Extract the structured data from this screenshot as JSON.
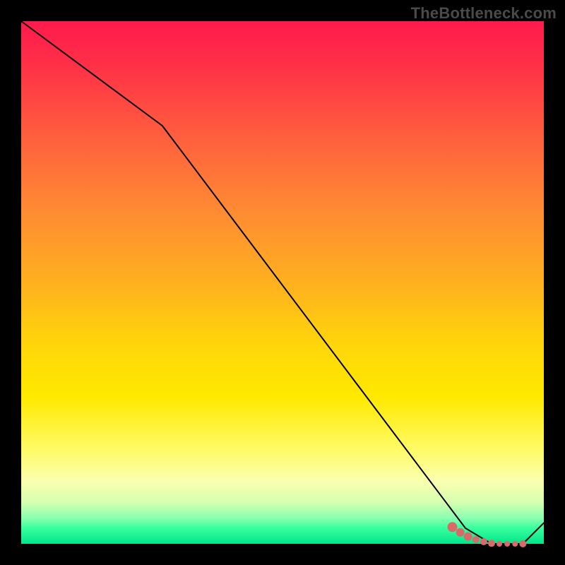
{
  "watermark": "TheBottleneck.com",
  "colors": {
    "background": "#000000",
    "curve": "#000000",
    "dots": "#d86a6a"
  },
  "chart_data": {
    "type": "line",
    "title": "",
    "xlabel": "",
    "ylabel": "",
    "xlim": [
      0,
      100
    ],
    "ylim": [
      0,
      100
    ],
    "grid": false,
    "legend": false,
    "series": [
      {
        "name": "bottleneck-curve",
        "x": [
          0,
          27,
          85,
          90,
          96,
          100
        ],
        "y": [
          100,
          80,
          3,
          0,
          0,
          4
        ]
      }
    ],
    "markers": {
      "name": "highlight-dots",
      "x": [
        82.5,
        84.0,
        85.5,
        87.0,
        88.5,
        90.0,
        91.5,
        93.0,
        94.5,
        96.0
      ],
      "y": [
        3.2,
        2.2,
        1.4,
        0.8,
        0.4,
        0.1,
        0.0,
        0.0,
        0.0,
        0.0
      ],
      "size": [
        7,
        6,
        6,
        5,
        5,
        5,
        4,
        4,
        4,
        5
      ]
    }
  }
}
